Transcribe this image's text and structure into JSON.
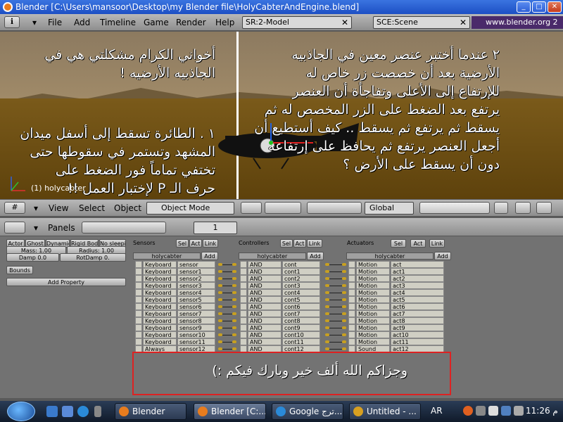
{
  "window": {
    "title": "Blender [C:\\Users\\mansoor\\Desktop\\my Blender file\\HolyCabterAndEngine.blend]"
  },
  "topmenu": {
    "items": [
      "File",
      "Add",
      "Timeline",
      "Game",
      "Render",
      "Help"
    ],
    "screen_field": "SR:2-Model",
    "scene_field": "SCE:Scene",
    "site": "www.blender.org 2"
  },
  "viewport": {
    "left_text_1": [
      "أخواني الكرام مشكلتي هي في",
      "الجاذبيه الأرضيه !"
    ],
    "left_text_2": [
      "١ . الطائرة تسقط إلى أسفل ميدان",
      "المشهد وتستمر في سقوطها حتى",
      "تختفي تماماً فور الضغط على",
      "حرف الـ P لإختبار العمل !!"
    ],
    "right_text": [
      "٢ عندما أختبر عنصر معين في الجاذبيه",
      "الأرضية بعد أن خصصت زر خاص له",
      "للإرتفاع إلى الأعلى وتفاجأة أن العنصر",
      "يرتفع بعد الضغط على الزر المخصص له ثم",
      "يسقط ثم يرتفع ثم يسقط .. كيف أستطيع أن",
      "أجعل العنصر يرتفع ثم يحافظ على إرتفاعه",
      "دون أن يسقط على الأرض ؟"
    ],
    "object_label": "(1) holycabter"
  },
  "viewheader": {
    "menus": [
      "View",
      "Select",
      "Object"
    ],
    "mode": "Object Mode",
    "orientation": "Global"
  },
  "logic": {
    "panels_label": "Panels",
    "page_number": "1",
    "physics_buttons": [
      "Actor",
      "Ghost",
      "Dynamic",
      "Rigid Bod",
      "No sleepi"
    ],
    "mass": "Mass: 1.00",
    "radius": "Radius: 1.00",
    "damp": "Damp 0.0",
    "rotdamp": "RotDamp 0.",
    "bounds": "Bounds",
    "add_property": "Add Property",
    "columns": {
      "sensors": "Sensors",
      "controllers": "Controllers",
      "actuators": "Actuators"
    },
    "col_buttons": [
      "Sel",
      "Act",
      "Link"
    ],
    "object_name": "holycabter",
    "add_label": "Add",
    "rows": [
      {
        "stype": "Keyboard",
        "sname": "sensor",
        "ctype": "AND",
        "cname": "cont",
        "atype": "Motion",
        "aname": "act"
      },
      {
        "stype": "Keyboard",
        "sname": "sensor1",
        "ctype": "AND",
        "cname": "cont1",
        "atype": "Motion",
        "aname": "act1"
      },
      {
        "stype": "Keyboard",
        "sname": "sensor2",
        "ctype": "AND",
        "cname": "cont2",
        "atype": "Motion",
        "aname": "act2"
      },
      {
        "stype": "Keyboard",
        "sname": "sensor3",
        "ctype": "AND",
        "cname": "cont3",
        "atype": "Motion",
        "aname": "act3"
      },
      {
        "stype": "Keyboard",
        "sname": "sensor4",
        "ctype": "AND",
        "cname": "cont4",
        "atype": "Motion",
        "aname": "act4"
      },
      {
        "stype": "Keyboard",
        "sname": "sensor5",
        "ctype": "AND",
        "cname": "cont5",
        "atype": "Motion",
        "aname": "act5"
      },
      {
        "stype": "Keyboard",
        "sname": "sensor6",
        "ctype": "AND",
        "cname": "cont6",
        "atype": "Motion",
        "aname": "act6"
      },
      {
        "stype": "Keyboard",
        "sname": "sensor7",
        "ctype": "AND",
        "cname": "cont7",
        "atype": "Motion",
        "aname": "act7"
      },
      {
        "stype": "Keyboard",
        "sname": "sensor8",
        "ctype": "AND",
        "cname": "cont8",
        "atype": "Motion",
        "aname": "act8"
      },
      {
        "stype": "Keyboard",
        "sname": "sensor9",
        "ctype": "AND",
        "cname": "cont9",
        "atype": "Motion",
        "aname": "act9"
      },
      {
        "stype": "Keyboard",
        "sname": "sensor10",
        "ctype": "AND",
        "cname": "cont10",
        "atype": "Motion",
        "aname": "act10"
      },
      {
        "stype": "Keyboard",
        "sname": "sensor11",
        "ctype": "AND",
        "cname": "cont11",
        "atype": "Motion",
        "aname": "act11"
      },
      {
        "stype": "Always",
        "sname": "sensor12",
        "ctype": "AND",
        "cname": "cont12",
        "atype": "Sound",
        "aname": "act12"
      }
    ]
  },
  "message": "وجزاكم الله ألف خير وبارك فيكم :)",
  "taskbar": {
    "tasks": [
      "Blender",
      "Blender [C:...",
      "Google ترج...",
      "Untitled - ..."
    ],
    "lang": "AR",
    "clock": "11:26 م"
  },
  "colors": {
    "title_bar": "#1d4fc4",
    "highlight_box": "#dd2222"
  }
}
